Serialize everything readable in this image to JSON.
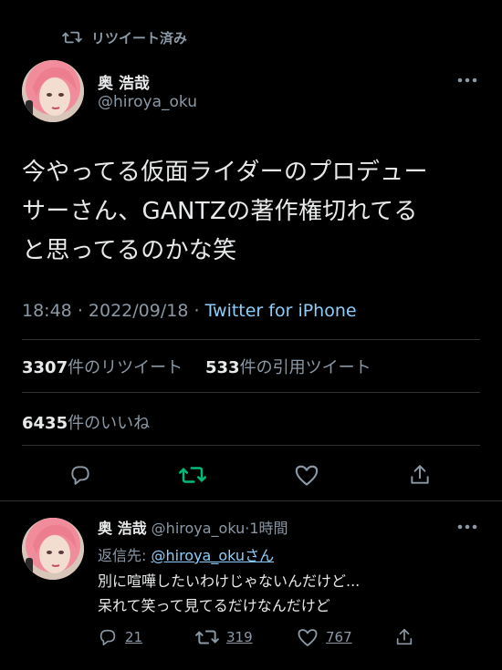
{
  "retweet_banner": {
    "label": "リツイート済み"
  },
  "tweet": {
    "author_name": "奥 浩哉",
    "author_handle": "@hiroya_oku",
    "text_lines": [
      "今やってる仮面ライダーのプロデュー",
      "サーさん、GANTZの著作権切れてる",
      "と思ってるのかな笑"
    ],
    "time": "18:48",
    "date": "2022/09/18",
    "client": "Twitter for iPhone",
    "retweets_count": "3307",
    "retweets_label": "件のリツイート",
    "quotes_count": "533",
    "quotes_label": "件の引用ツイート",
    "likes_count": "6435",
    "likes_label": "件のいいね"
  },
  "reply": {
    "author_name": "奥 浩哉",
    "author_handle": "@hiroya_oku",
    "time_ago": "1時間",
    "reply_prefix": "返信先: ",
    "reply_mention": "@hiroya_oku",
    "reply_suffix": "さん",
    "text_lines": [
      "別に喧嘩したいわけじゃないんだけど...",
      "呆れて笑って見てるだけなんだけど"
    ],
    "reply_count": "21",
    "retweet_count": "319",
    "like_count": "767"
  },
  "colors": {
    "background": "#000000",
    "text": "#e7e9ea",
    "muted": "#8b98a5",
    "link": "#8ecdf8",
    "retweet_active": "#00ba7c",
    "divider": "#2f3336"
  },
  "icons": [
    "retweet-icon",
    "more-icon",
    "reply-icon",
    "like-icon",
    "share-icon",
    "avatar"
  ]
}
